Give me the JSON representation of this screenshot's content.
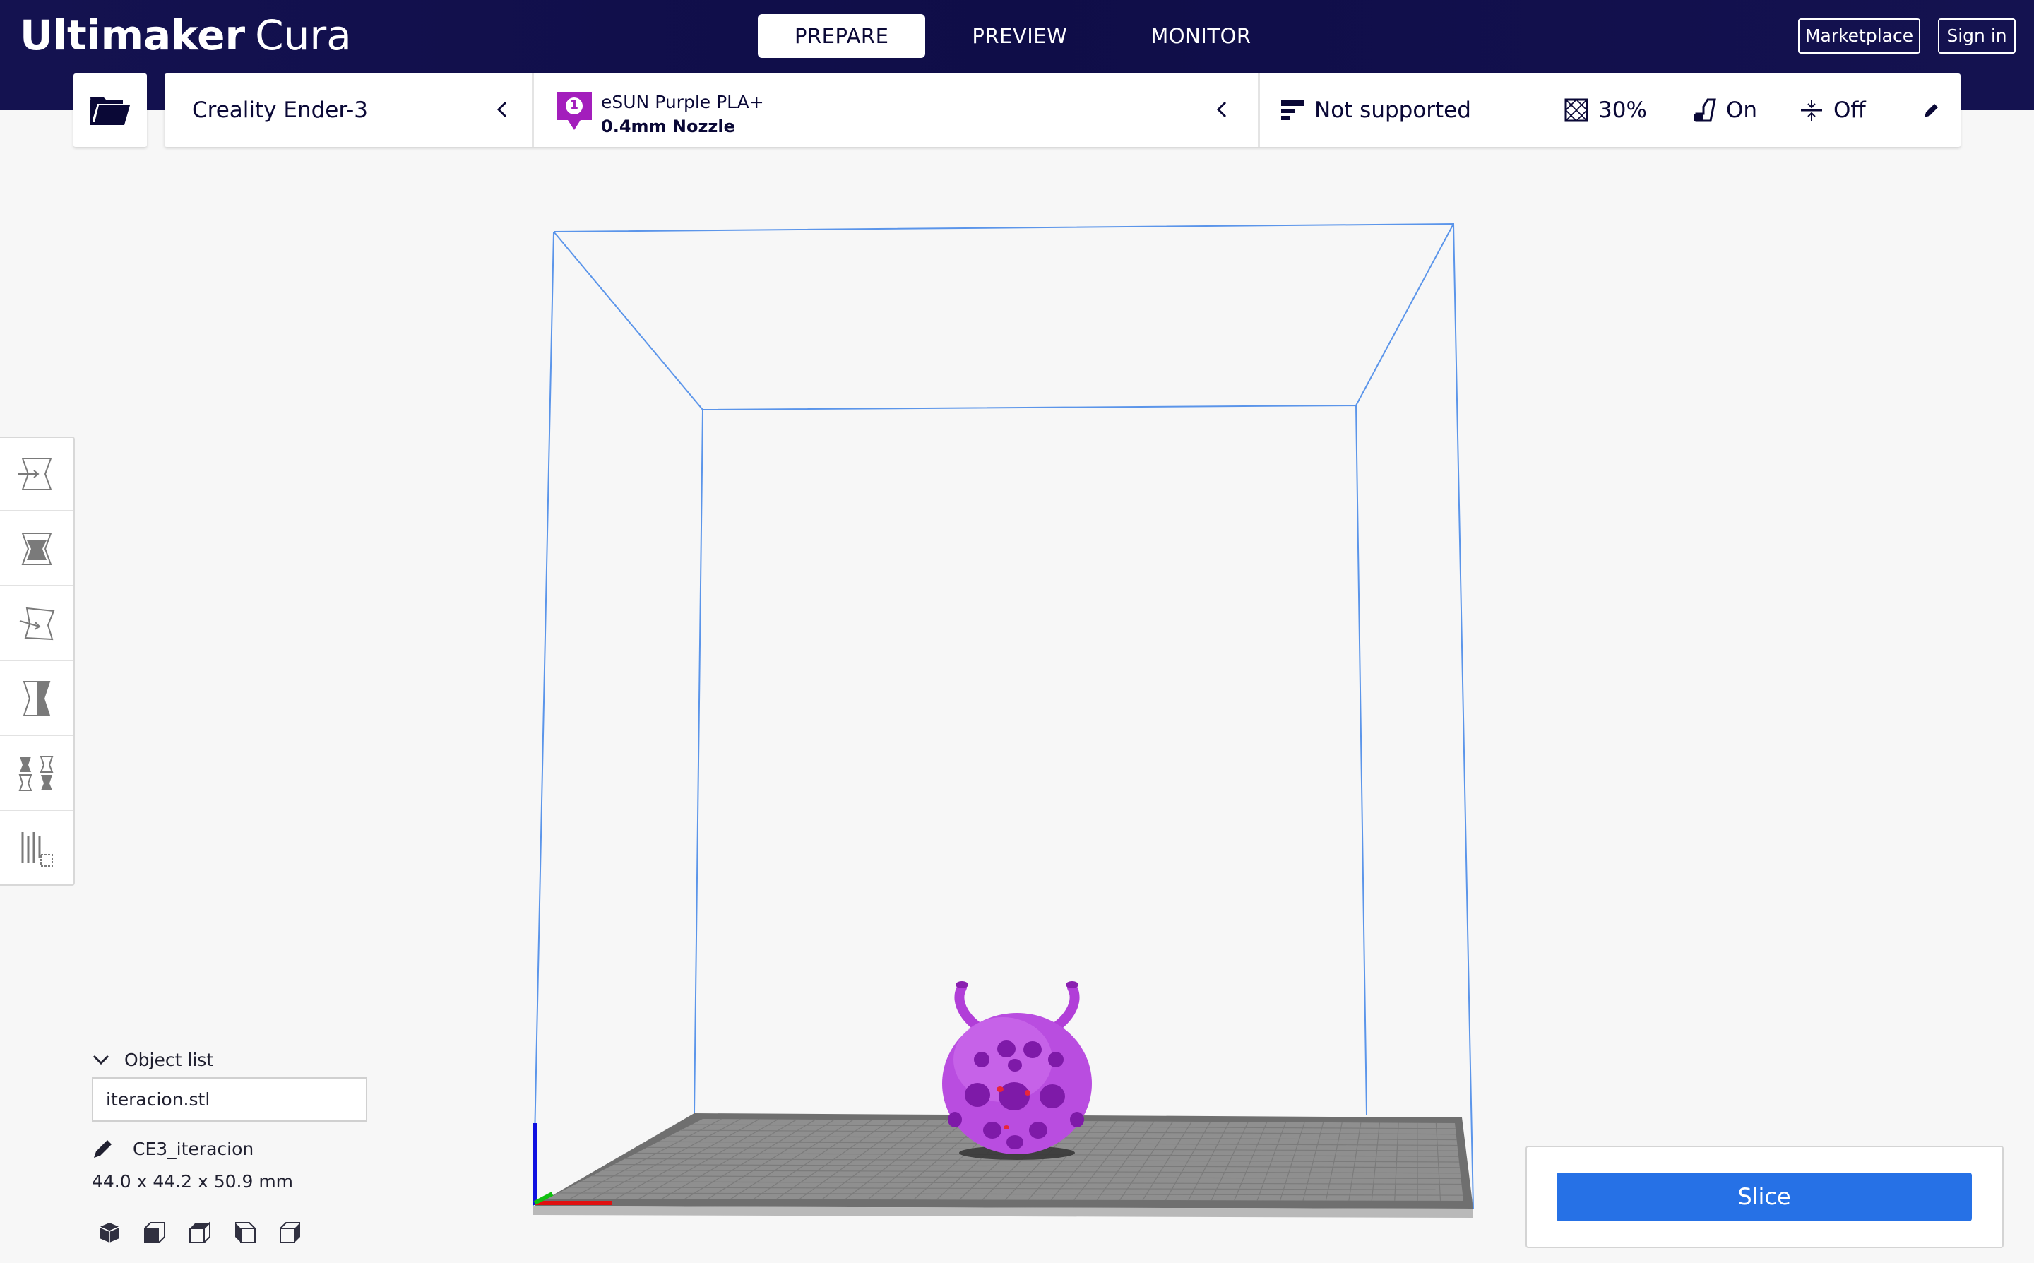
{
  "app": {
    "brand": "Ultimaker",
    "product": "Cura"
  },
  "stages": [
    {
      "label": "PREPARE",
      "active": true
    },
    {
      "label": "PREVIEW",
      "active": false
    },
    {
      "label": "MONITOR",
      "active": false
    }
  ],
  "header_buttons": {
    "marketplace": "Marketplace",
    "sign_in": "Sign in"
  },
  "printer": {
    "name": "Creality Ender-3"
  },
  "material": {
    "extruder_index": "1",
    "name": "eSUN Purple PLA+",
    "nozzle": "0.4mm Nozzle",
    "color": "#a31ebc"
  },
  "print_settings": {
    "profile": "Not supported",
    "infill": "30%",
    "support": "On",
    "adhesion": "Off"
  },
  "tools": [
    "move-tool",
    "scale-tool",
    "rotate-tool",
    "mirror-tool",
    "per-model-settings-tool",
    "support-blocker-tool"
  ],
  "object_list": {
    "header": "Object list",
    "items": [
      "iteracion.stl"
    ],
    "job_name": "CE3_iteracion",
    "dimensions": "44.0 x 44.2 x 50.9 mm"
  },
  "view_buttons": [
    "3d-view",
    "front-view",
    "top-view",
    "left-view",
    "right-view"
  ],
  "slice": {
    "label": "Slice"
  },
  "colors": {
    "header_bg": "#12104a",
    "accent_blue": "#2671e6",
    "build_volume_line": "#4a8ae6",
    "model_color": "#b13ed8"
  }
}
